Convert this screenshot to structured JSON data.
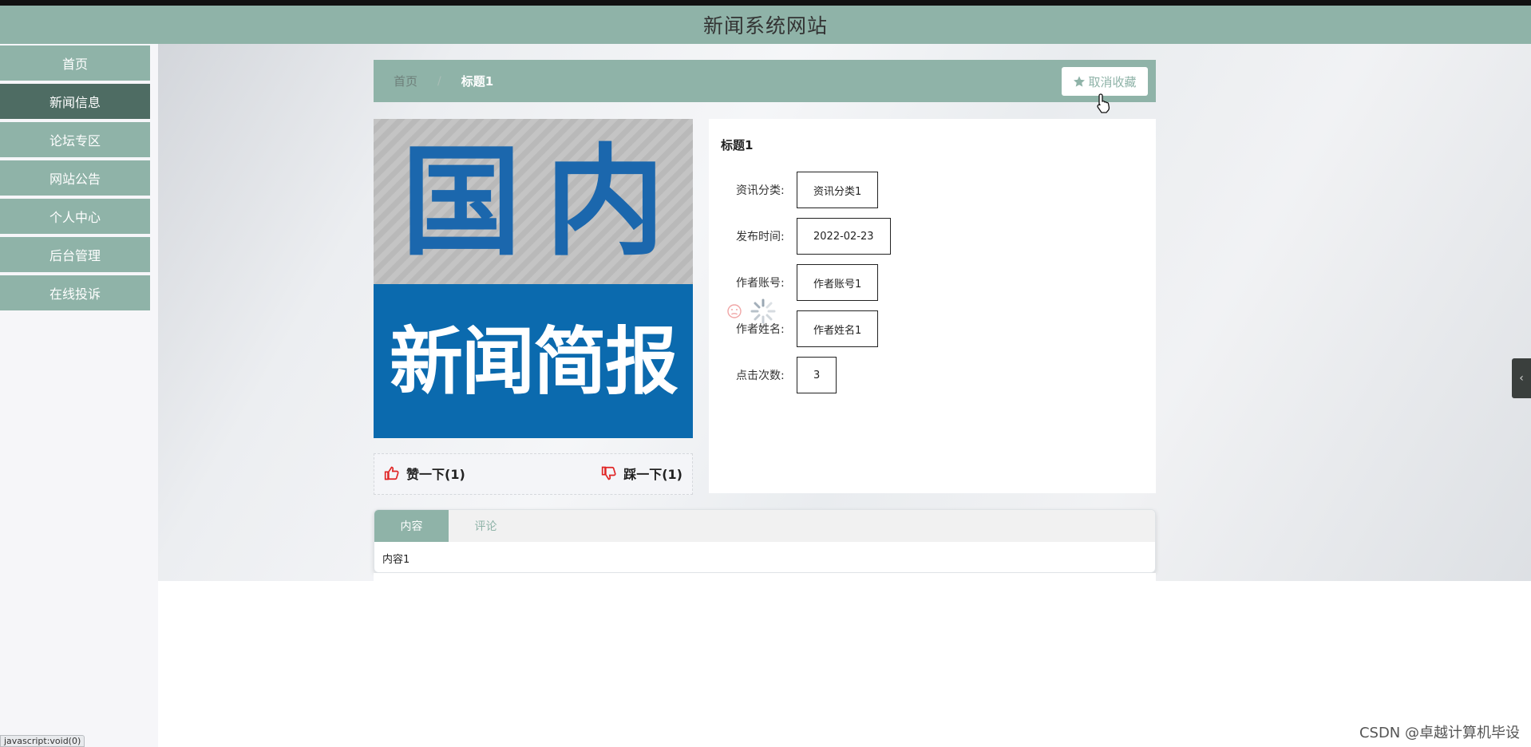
{
  "header": {
    "title": "新闻系统网站"
  },
  "sidebar": {
    "items": [
      {
        "label": "首页",
        "active": false
      },
      {
        "label": "新闻信息",
        "active": true
      },
      {
        "label": "论坛专区",
        "active": false
      },
      {
        "label": "网站公告",
        "active": false
      },
      {
        "label": "个人中心",
        "active": false
      },
      {
        "label": "后台管理",
        "active": false
      },
      {
        "label": "在线投诉",
        "active": false
      }
    ]
  },
  "breadcrumb": {
    "home": "首页",
    "separator": "/",
    "current": "标题1"
  },
  "favorite_button": {
    "label": "取消收藏",
    "icon": "star-icon"
  },
  "news_image": {
    "line1": "国内",
    "line2": "新闻简报"
  },
  "votes": {
    "like_label": "赞一下(1)",
    "dislike_label": "踩一下(1)"
  },
  "detail": {
    "title": "标题1",
    "fields": [
      {
        "label": "资讯分类:",
        "value": "资讯分类1"
      },
      {
        "label": "发布时间:",
        "value": "2022-02-23"
      },
      {
        "label": "作者账号:",
        "value": "作者账号1"
      },
      {
        "label": "作者姓名:",
        "value": "作者姓名1"
      },
      {
        "label": "点击次数:",
        "value": "3"
      }
    ]
  },
  "tabs": {
    "items": [
      {
        "label": "内容",
        "active": true
      },
      {
        "label": "评论",
        "active": false
      }
    ],
    "content": "内容1"
  },
  "right_toggle": {
    "icon": "chevron-left-icon",
    "glyph": "‹"
  },
  "status_bar": {
    "url": "javascript:void(0)"
  },
  "watermark": "CSDN @卓越计算机毕设",
  "colors": {
    "accent": "#8fb3a8",
    "active_nav": "#4e6c63",
    "image_blue": "#0b6aae",
    "thumb_red": "#e02424"
  }
}
